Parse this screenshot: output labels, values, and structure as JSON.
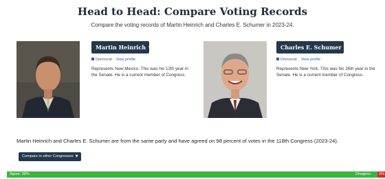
{
  "header": {
    "title": "Head to Head: Compare Voting Records",
    "subtitle": "Compare the voting records of Martin Heinrich and Charles E. Schumer in 2023-24."
  },
  "left_member": {
    "name": "Martin Heinrich",
    "party": "Democrat",
    "profile_link": "View profile",
    "description": "Represents New Mexico. This was his 12th year in the Senate. He is a current member of Congress."
  },
  "right_member": {
    "name": "Charles E. Schumer",
    "party": "Democrat",
    "profile_link": "View profile",
    "description": "Represents New York. This was his 26th year in the Senate. He is a current member of Congress."
  },
  "summary": "Martin Heinrich and Charles E. Schumer are from the same party and have agreed on 98 percent of votes in the 118th Congress (2023-24).",
  "compare_button": "Compare in other Congresses",
  "agreement_bar": {
    "agree_label": "Agree: 98%",
    "disagree_label": "Disagree",
    "disagree_pct": "2%",
    "agree_percent": 98,
    "agree_color": "#3bb53a",
    "disagree_color": "#d22f2f"
  },
  "colors": {
    "button_bg": "#24384c",
    "party_dem": "#2a5bb0"
  }
}
